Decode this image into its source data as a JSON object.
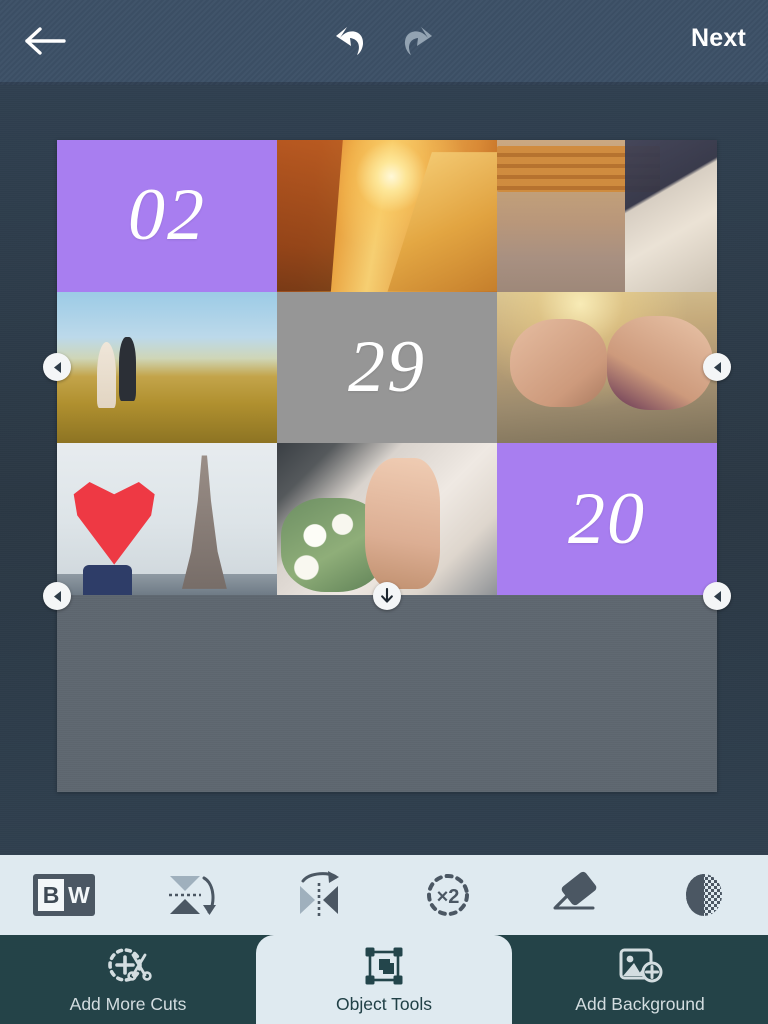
{
  "topbar": {
    "back_icon": "arrow-left-icon",
    "undo_icon": "undo-icon",
    "redo_icon": "redo-icon",
    "next_label": "Next",
    "background_color": "#3c5066"
  },
  "workspace": {
    "background_color": "#2e3c48",
    "canvas_color": "#5e6770",
    "selection_handles": [
      {
        "name": "handle-left",
        "glyph": "◀"
      },
      {
        "name": "handle-right",
        "glyph": "◀"
      },
      {
        "name": "handle-bottom-left",
        "glyph": "◀"
      },
      {
        "name": "handle-bottom-center",
        "glyph": "↓"
      },
      {
        "name": "handle-bottom-right",
        "glyph": "◀"
      }
    ]
  },
  "collage": {
    "rows": 3,
    "columns": 3,
    "purple_color": "#a87ef0",
    "gray_color": "#969696",
    "tiles": [
      {
        "id": 1,
        "type": "number",
        "value": "02",
        "background": "#a87ef0"
      },
      {
        "id": 2,
        "type": "photo",
        "value": "",
        "subject": "couple-holding-hands-sunset"
      },
      {
        "id": 3,
        "type": "photo",
        "value": "",
        "subject": "couple-on-park-bench"
      },
      {
        "id": 4,
        "type": "photo",
        "value": "",
        "subject": "couple-walking-in-field"
      },
      {
        "id": 5,
        "type": "number",
        "value": "29",
        "background": "#969696"
      },
      {
        "id": 6,
        "type": "photo",
        "value": "",
        "subject": "hands-pinky-promise"
      },
      {
        "id": 7,
        "type": "photo",
        "value": "",
        "subject": "red-heart-umbrella-eiffel-tower"
      },
      {
        "id": 8,
        "type": "photo",
        "value": "",
        "subject": "bride-with-bouquet"
      },
      {
        "id": 9,
        "type": "number",
        "value": "20",
        "background": "#a87ef0"
      }
    ]
  },
  "toolstrip": {
    "background_color": "#dfeaf0",
    "tools": [
      {
        "name": "black-and-white-tool",
        "icon": "bw-icon",
        "label_b": "B",
        "label_w": "W"
      },
      {
        "name": "flip-vertical-tool",
        "icon": "flip-vertical-icon"
      },
      {
        "name": "flip-horizontal-tool",
        "icon": "flip-horizontal-icon"
      },
      {
        "name": "duplicate-tool",
        "icon": "duplicate-x2-icon",
        "label": "×2"
      },
      {
        "name": "eraser-tool",
        "icon": "eraser-icon"
      },
      {
        "name": "opacity-tool",
        "icon": "opacity-checker-icon"
      }
    ]
  },
  "bottomnav": {
    "background_color": "#244348",
    "active_background_color": "#dfeaf0",
    "items": [
      {
        "name": "add-more-cuts-tab",
        "label": "Add More Cuts",
        "icon": "cut-plus-icon",
        "active": false
      },
      {
        "name": "object-tools-tab",
        "label": "Object Tools",
        "icon": "object-selection-icon",
        "active": true
      },
      {
        "name": "add-background-tab",
        "label": "Add Background",
        "icon": "image-plus-icon",
        "active": false
      }
    ]
  }
}
